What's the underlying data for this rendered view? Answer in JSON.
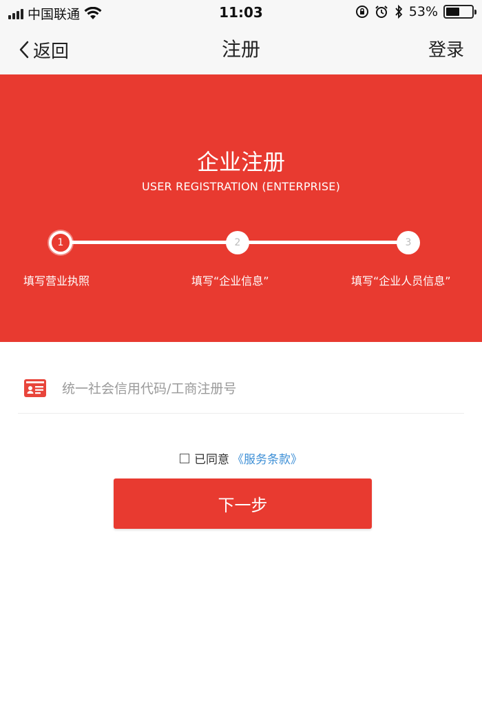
{
  "status_bar": {
    "carrier": "中国联通",
    "time": "11:03",
    "battery_percent": "53%",
    "battery_level": 0.53,
    "icons": [
      "signal-icon",
      "wifi-icon",
      "rotation-lock-icon",
      "alarm-icon",
      "bluetooth-icon",
      "battery-icon"
    ]
  },
  "nav": {
    "back_label": "返回",
    "title": "注册",
    "login_label": "登录"
  },
  "hero": {
    "title": "企业注册",
    "subtitle": "USER REGISTRATION (ENTERPRISE)",
    "steps": [
      {
        "number": "1",
        "label": "填写营业执照",
        "active": true
      },
      {
        "number": "2",
        "label": "填写“企业信息”",
        "active": false
      },
      {
        "number": "3",
        "label": "填写“企业人员信息”",
        "active": false
      }
    ]
  },
  "form": {
    "credit_placeholder": "统一社会信用代码/工商注册号",
    "credit_value": "",
    "agree_text": "已同意",
    "terms_label": "《服务条款》",
    "agree_checked": false,
    "next_label": "下一步"
  },
  "colors": {
    "brand_red": "#e83a30",
    "link_blue": "#3d8fd6",
    "nav_bg": "#f7f7f7"
  }
}
